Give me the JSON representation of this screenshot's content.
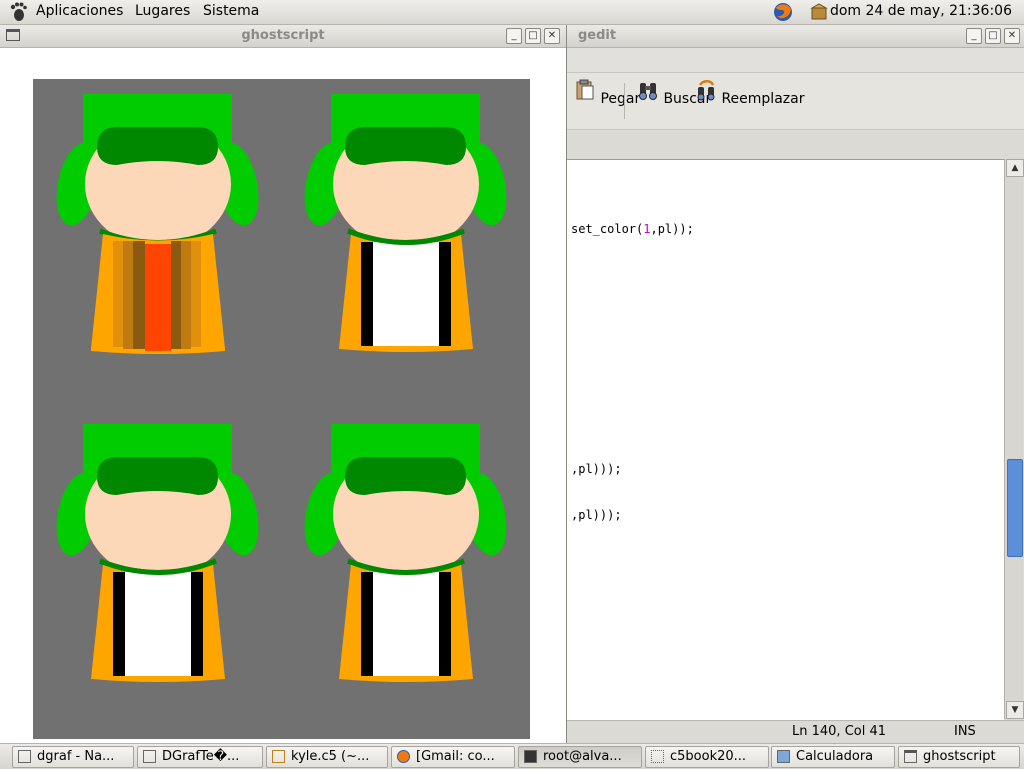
{
  "top_panel": {
    "menus": [
      "Aplicaciones",
      "Lugares",
      "Sistema"
    ],
    "clock": "dom 24 de may, 21:36:06"
  },
  "gedit": {
    "title": "gedit",
    "toolbar": {
      "paste_label": "Pegar",
      "search_label": "Buscar",
      "replace_label": "Reemplazar"
    },
    "code_lines": {
      "line1_pre": "set_color(",
      "line1_num": "1",
      "line1_post": ",pl));",
      "line2": ",pl)));",
      "line3": ",pl)));"
    },
    "status": {
      "position": "Ln 140, Col 41",
      "mode": "INS"
    }
  },
  "ghostscript": {
    "title": "ghostscript"
  },
  "taskbar": {
    "items": [
      "dgraf - Na...",
      "DGrafTe�...",
      "kyle.c5 (~...",
      "[Gmail: co...",
      "root@alva...",
      "c5book20...",
      "Calculadora",
      "ghostscript"
    ]
  },
  "colors": {
    "hat_green": "#00cc00",
    "hat_band": "#008800",
    "skin": "#fdd8b8",
    "coat_orange": "#ffa500",
    "zipper_red": "#ff4500",
    "shirt_white": "#ffffff",
    "canvas_gray": "#717171",
    "scroll_thumb": "#5b8fd9"
  }
}
